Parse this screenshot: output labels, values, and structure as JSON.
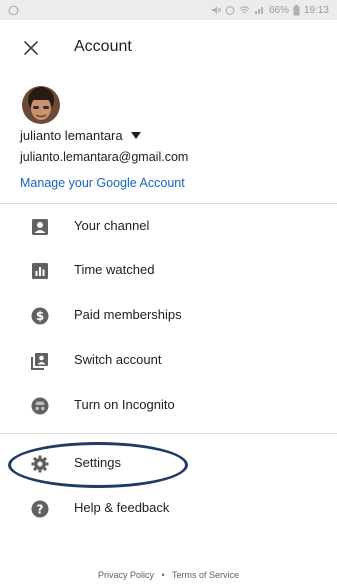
{
  "status_bar": {
    "battery": "66%",
    "time": "19:13"
  },
  "header": {
    "title": "Account"
  },
  "profile": {
    "name": "julianto lemantara",
    "email": "julianto.lemantara@gmail.com",
    "manage_link": "Manage your Google Account"
  },
  "menu": {
    "items": [
      {
        "label": "Your channel",
        "icon": "channel-icon"
      },
      {
        "label": "Time watched",
        "icon": "bar-chart-icon"
      },
      {
        "label": "Paid memberships",
        "icon": "dollar-icon"
      },
      {
        "label": "Switch account",
        "icon": "switch-account-icon"
      },
      {
        "label": "Turn on Incognito",
        "icon": "incognito-icon"
      },
      {
        "label": "Settings",
        "icon": "gear-icon"
      },
      {
        "label": "Help & feedback",
        "icon": "help-icon"
      }
    ]
  },
  "footer": {
    "privacy": "Privacy Policy",
    "separator": "•",
    "terms": "Terms of Service"
  },
  "colors": {
    "link": "#1565c0",
    "icon": "#616161",
    "highlight": "#1f3b63"
  }
}
